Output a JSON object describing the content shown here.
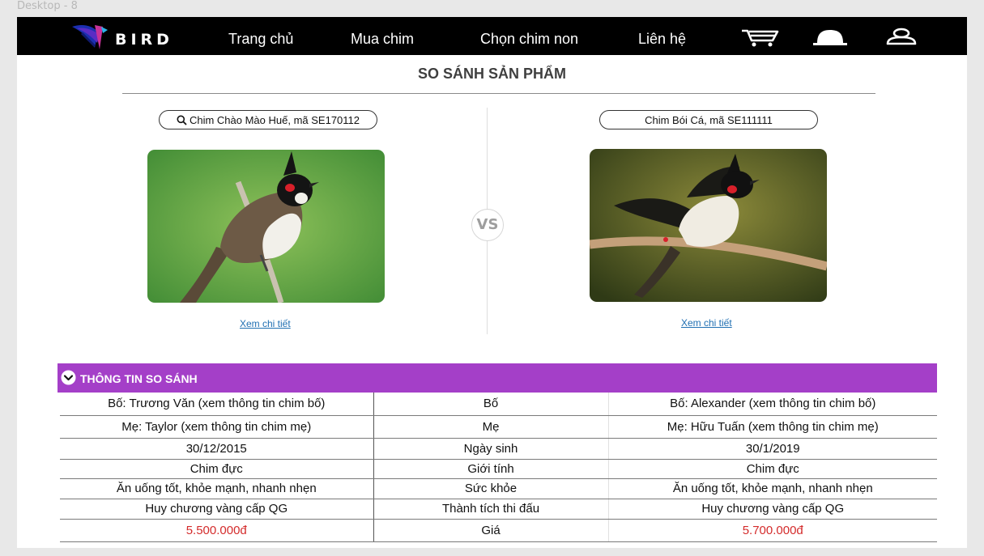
{
  "frame_label": "Desktop - 8",
  "nav": {
    "logo_text": "BIRD",
    "items": [
      "Trang chủ",
      "Mua chim",
      "Chọn chim non",
      "Liên hệ"
    ],
    "icons": [
      "cart-icon",
      "bell-icon",
      "user-icon"
    ]
  },
  "page": {
    "title": "SO SÁNH SẢN PHẨM",
    "vs_label": "VS"
  },
  "left": {
    "search_value": "Chim Chào Mào Huế, mã SE170112",
    "detail_link": "Xem chi tiết"
  },
  "right": {
    "search_value": "Chim Bói Cá, mã SE111111",
    "detail_link": "Xem chi tiết"
  },
  "compare": {
    "section_title": "THÔNG TIN SO SÁNH",
    "rows": [
      {
        "left": "Bố: Trương Văn (xem thông tin chim bố)",
        "label": "Bố",
        "right": "Bố: Alexander (xem thông tin chim bố)"
      },
      {
        "left": "Mẹ: Taylor (xem thông tin chim mẹ)",
        "label": "Mẹ",
        "right": "Mẹ: Hữu Tuấn (xem thông tin chim mẹ)"
      },
      {
        "left": "30/12/2015",
        "label": "Ngày sinh",
        "right": "30/1/2019"
      },
      {
        "left": "Chim đực",
        "label": "Giới tính",
        "right": "Chim đực"
      },
      {
        "left": "Ăn uống tốt, khỏe mạnh, nhanh nhẹn",
        "label": "Sức khỏe",
        "right": "Ăn uống tốt, khỏe mạnh, nhanh nhẹn"
      },
      {
        "left": "Huy chương vàng cấp QG",
        "label": "Thành tích thi đấu",
        "right": "Huy chương vàng cấp QG"
      },
      {
        "left": "5.500.000đ",
        "label": "Giá",
        "right": "5.700.000đ"
      }
    ]
  },
  "colors": {
    "navbar": "#000000",
    "section_bar": "#a43fc8",
    "price": "#d42b2b",
    "link": "#1f6fb2"
  }
}
